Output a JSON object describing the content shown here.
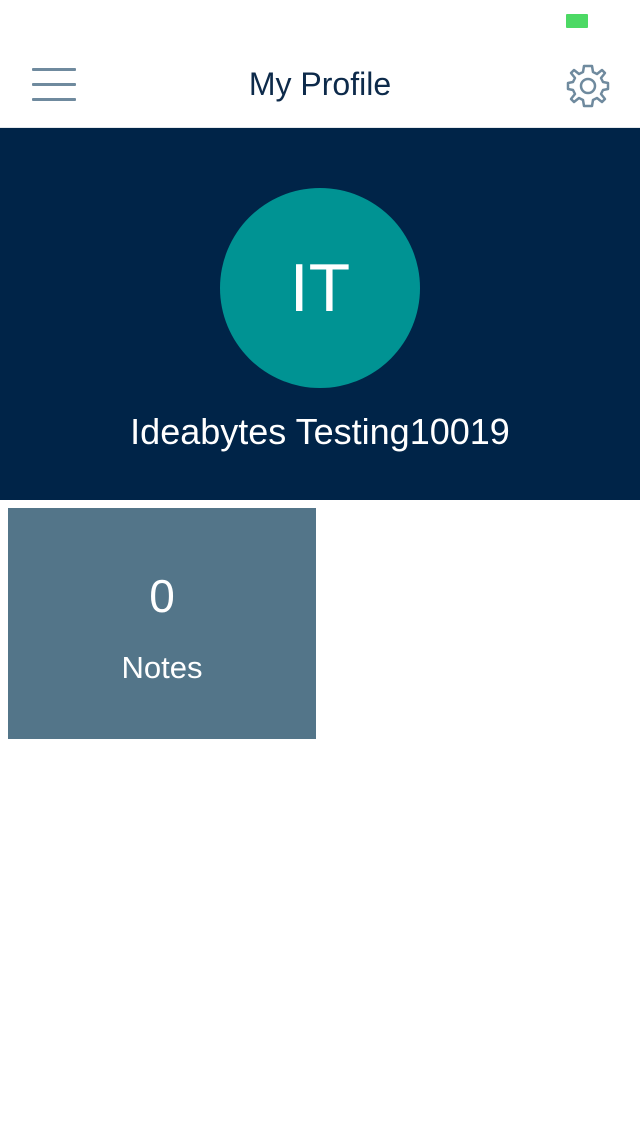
{
  "status_bar": {
    "battery_color": "#4cd964"
  },
  "nav": {
    "title": "My Profile",
    "menu_icon": "hamburger-menu-icon",
    "settings_icon": "gear-icon"
  },
  "profile": {
    "initials": "IT",
    "name": "Ideabytes Testing10019",
    "avatar_color": "#009393",
    "header_color": "#002448"
  },
  "stats": [
    {
      "value": "0",
      "label": "Notes",
      "tile_color": "#537589"
    }
  ]
}
